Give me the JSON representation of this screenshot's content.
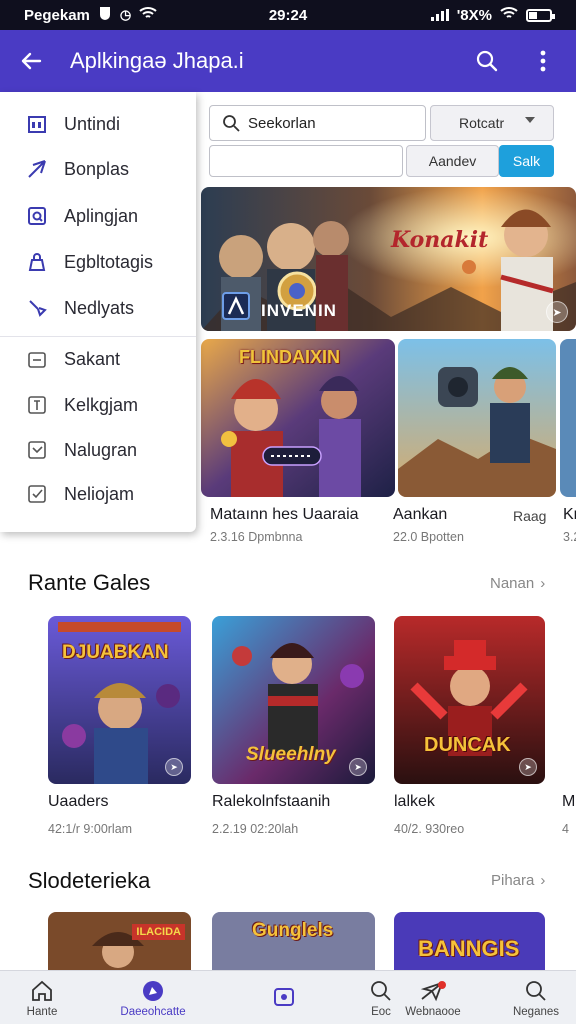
{
  "status": {
    "left": "Pegekam",
    "time": "29:24",
    "battery": "'8X%"
  },
  "appbar": {
    "title": "Aplkingaə Jhapa.i"
  },
  "drawer": [
    {
      "label": "Untindi",
      "icon": "calendar-icon"
    },
    {
      "label": "Bonplas",
      "icon": "send-icon"
    },
    {
      "label": "Aplingjan",
      "icon": "edit-box-icon"
    },
    {
      "label": "Egbltotagis",
      "icon": "bag-icon"
    },
    {
      "label": "Nedlyats",
      "icon": "tools-icon"
    },
    {
      "label": "Sakant",
      "icon": "message-box-icon"
    },
    {
      "label": "Kelkgjam",
      "icon": "t-box-icon"
    },
    {
      "label": "Nalugran",
      "icon": "check-box-icon"
    },
    {
      "label": "Neliojam",
      "icon": "check-square-icon"
    }
  ],
  "search": {
    "value": "Seekorlan",
    "category": "Rotcatr",
    "field2": "",
    "button1": "Aandev",
    "button2": "Salk"
  },
  "featured": {
    "hero": {
      "logo_text": "INVENIN",
      "script_text": "Konakit"
    },
    "row2_badge": "FLINDAIXIN",
    "items": [
      {
        "title": "Mataınn hes Uaaraia",
        "sub": "2.3.16  Dpmbnna"
      },
      {
        "title": "Aankan",
        "sub": "22.0  Bpotten",
        "tag": "Raag"
      },
      {
        "title": "Kr",
        "sub": "3.2"
      }
    ]
  },
  "section1": {
    "heading": "Rante Gales",
    "more": "Nanan",
    "items": [
      {
        "title": "Uaaders",
        "sub": "42:1/r  9:00rlam",
        "art": "DJUABKAN"
      },
      {
        "title": "Ralekolnfstaanih",
        "sub": "2.2.19  02:20lah",
        "art": "Slueehlny"
      },
      {
        "title": "lalkek",
        "sub": "40/2.  930reo",
        "art": "DUNCAK"
      },
      {
        "title": "M",
        "sub": "4"
      }
    ]
  },
  "section2": {
    "heading": "Slodeterieka",
    "more": "Pihara",
    "arts": [
      "ILACIDA",
      "Gunglels",
      "BANNGIS"
    ]
  },
  "nav": [
    {
      "label": "Hante",
      "icon": "home-icon"
    },
    {
      "label": "Daeeohcatte",
      "icon": "compass-icon",
      "active": true
    },
    {
      "label": "",
      "icon": "media-icon"
    },
    {
      "label": "Eoc",
      "icon": "search-icon"
    },
    {
      "label": "Webnaooe",
      "icon": "plane-icon"
    },
    {
      "label": "Neganes",
      "icon": "search2-icon"
    }
  ],
  "colors": {
    "appbar": "#4a3bc4",
    "accent_button": "#1ea0dc",
    "status_bar": "#0f0f1e"
  }
}
